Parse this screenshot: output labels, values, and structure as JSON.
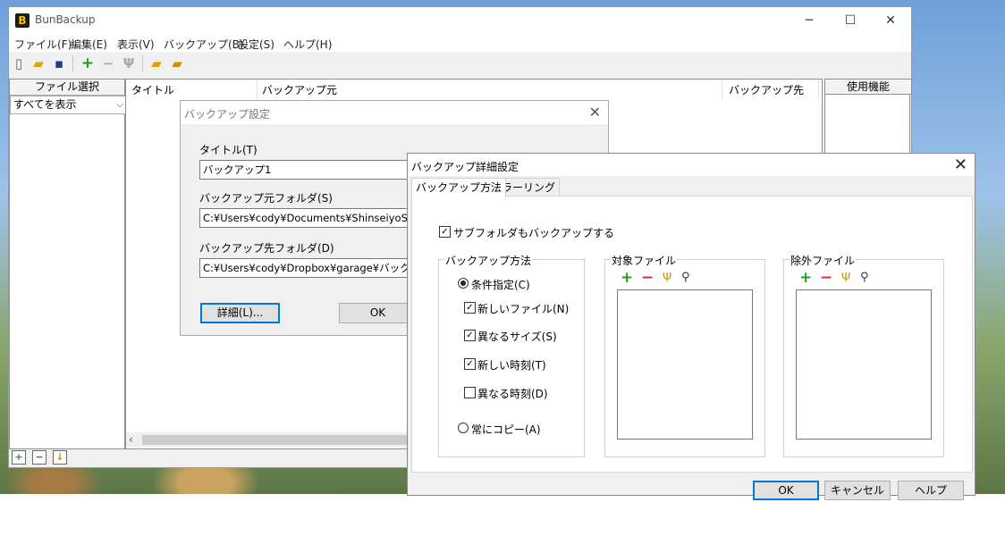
{
  "window": {
    "title": "BunBackup",
    "minimize": "─",
    "maximize": "☐",
    "close": "✕"
  },
  "menu": [
    "ファイル(F)",
    "編集(E)",
    "表示(V)",
    "バックアップ(B)",
    "設定(S)",
    "ヘルプ(H)"
  ],
  "toolbar": {
    "new": "▯",
    "open": "▰",
    "save": "▪",
    "add": "+",
    "remove": "−",
    "edit": "Ψ"
  },
  "left_panel": {
    "header": "ファイル選択",
    "filter_value": "すべてを表示"
  },
  "list_panel": {
    "columns": [
      "タイトル",
      "バックアップ元",
      "バックアップ先"
    ]
  },
  "right_panel": {
    "header": "使用機能"
  },
  "bottom_icons": {
    "add": "+",
    "remove": "−",
    "down": "↓"
  },
  "backup_dialog": {
    "title": "バックアップ設定",
    "title_label": "タイトル(T)",
    "title_value": "バックアップ1",
    "source_label": "バックアップ元フォルダ(S)",
    "source_value": "C:¥Users¥cody¥Documents¥ShinseiyoSogo",
    "dest_label": "バックアップ先フォルダ(D)",
    "dest_value": "C:¥Users¥cody¥Dropbox¥garage¥バックアップ",
    "details_button": "詳細(L)...",
    "ok_button": "OK"
  },
  "advanced_dialog": {
    "title": "バックアップ詳細設定",
    "tabs": [
      "バックアップ方法",
      "ミラーリング"
    ],
    "subfolder_label": "サブフォルダもバックアップする",
    "subfolder_checked": true,
    "method_group": "バックアップ方法",
    "radio_conditional": "条件指定(C)",
    "cond_new_file": "新しいファイル(N)",
    "cond_diff_size": "異なるサイズ(S)",
    "cond_new_time": "新しい時刻(T)",
    "cond_diff_time": "異なる時刻(D)",
    "radio_always": "常にコピー(A)",
    "checked": {
      "new_file": true,
      "diff_size": true,
      "new_time": true,
      "diff_time": false
    },
    "selected_method": "conditional",
    "target_group": "対象ファイル",
    "exclude_group": "除外ファイル",
    "icons": {
      "add": "+",
      "remove": "−",
      "edit": "Ψ",
      "search": "⚲"
    },
    "check_glyph": "✓",
    "ok_button": "OK",
    "cancel_button": "キャンセル",
    "help_button": "ヘルプ"
  },
  "colors": {
    "add": "#1e9e1e",
    "remove": "#d52b2b",
    "accent_border": "#0078d7"
  }
}
